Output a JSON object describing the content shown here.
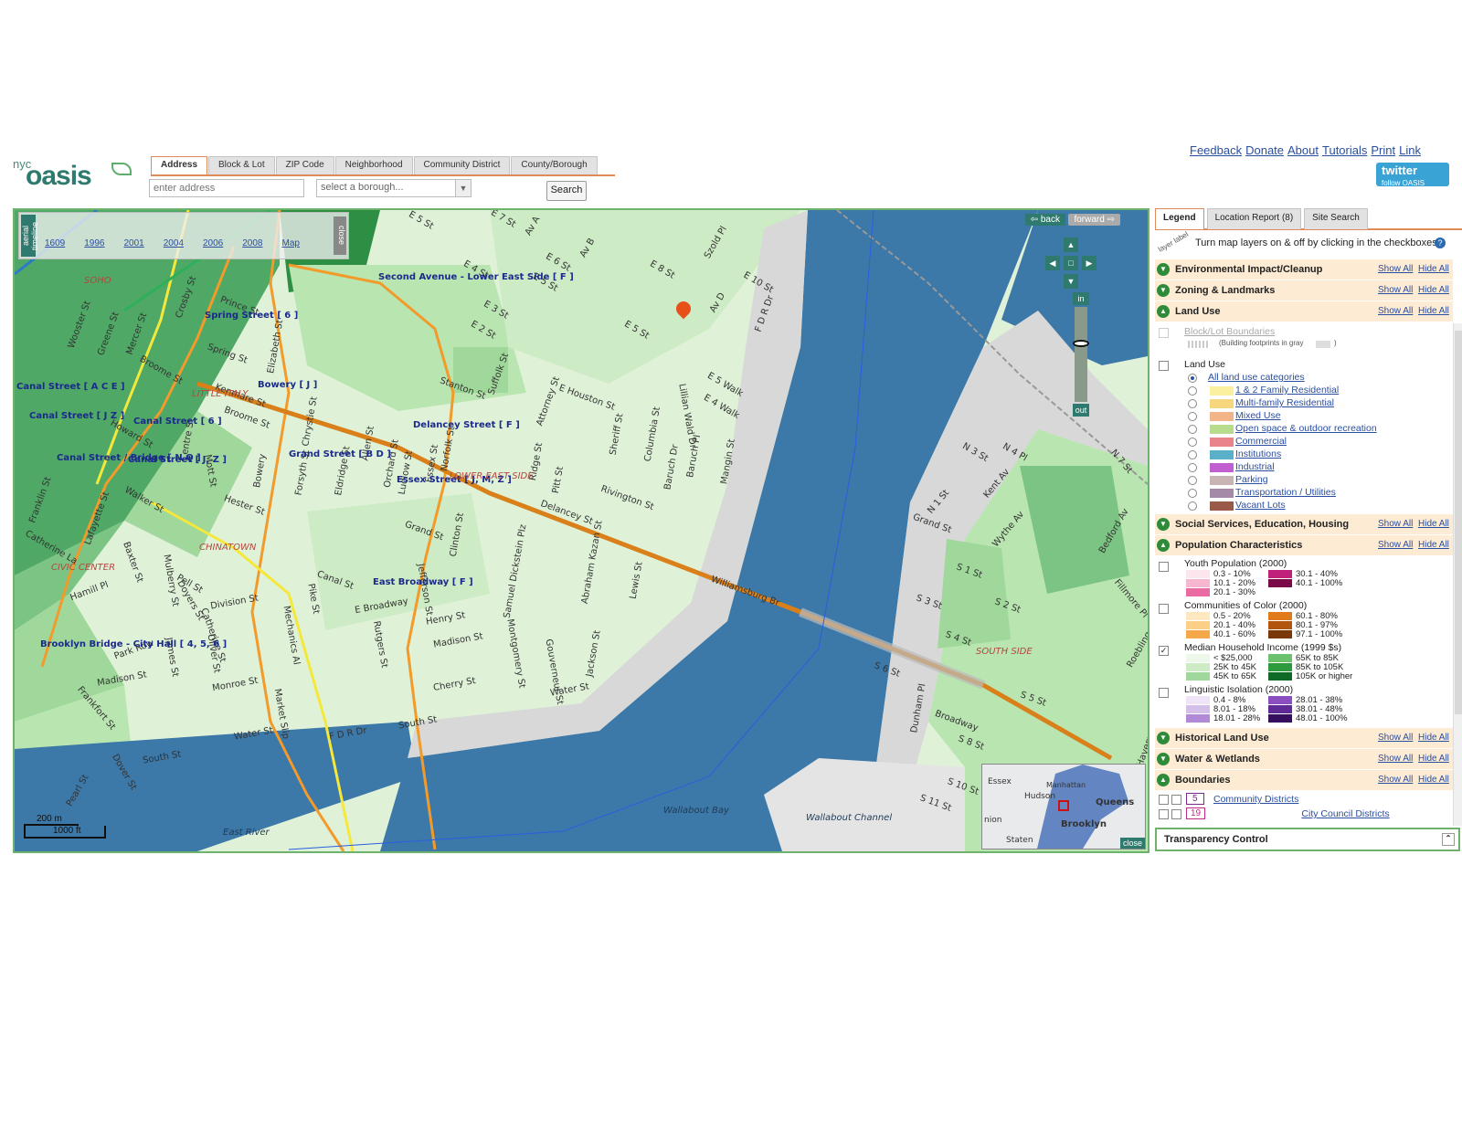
{
  "header": {
    "logo_small": "nyc",
    "logo_big": "oasis",
    "search_tabs": [
      "Address",
      "Block & Lot",
      "ZIP Code",
      "Neighborhood",
      "Community District",
      "County/Borough"
    ],
    "address_placeholder": "enter address",
    "borough_placeholder": "select a borough...",
    "search_label": "Search",
    "links": [
      "Feedback",
      "Donate",
      "About",
      "Tutorials",
      "Print",
      "Link"
    ],
    "twitter": "twitter",
    "twitter_sub": "follow OASIS"
  },
  "map": {
    "timeline_label": "aerial timeline",
    "timeline_years": [
      "1609",
      "1996",
      "2001",
      "2004",
      "2006",
      "2008",
      "Map"
    ],
    "timeline_close": "close",
    "back": "back",
    "forward": "forward",
    "zoom_in": "in",
    "zoom_out": "out",
    "overview_close": "close",
    "overview_labels": [
      "Essex",
      "Hudson",
      "Manhattan",
      "Queens",
      "Brooklyn",
      "Staten",
      "nion"
    ],
    "scale_m": "200 m",
    "scale_ft": "1000 ft",
    "streets": [
      "E 5 St",
      "E 7 St",
      "Av A",
      "E 4 St",
      "E 6 St",
      "Av B",
      "E 8 St",
      "Szold Pl",
      "E 3 St",
      "E 5 St",
      "E 2 St",
      "E 5 St",
      "Av D",
      "E 10 St",
      "F D R Dr",
      "E 5 Walk",
      "E 4 Walk",
      "E Houston St",
      "Stanton St",
      "Suffolk St",
      "Attorney St",
      "Rivington St",
      "Delancey St",
      "Grand St",
      "Broome St",
      "Hester St",
      "Canal St",
      "E Broadway",
      "Henry St",
      "Madison St",
      "Cherry St",
      "Water St",
      "South St",
      "Pike St",
      "Rutgers St",
      "Jefferson St",
      "Division St",
      "Catherine St",
      "Monroe St",
      "Market Slip",
      "Madison St",
      "Walker St",
      "Baxter St",
      "Mulberry St",
      "Mott St",
      "Bowery",
      "Elizabeth St",
      "Chrystie St",
      "Forsyth St",
      "Eldridge St",
      "Allen St",
      "Orchard St",
      "Ludlow St",
      "Essex St",
      "Norfolk St",
      "Clinton St",
      "Ridge St",
      "Pitt St",
      "Sheriff St",
      "Columbia St",
      "Lewis St",
      "Mangin St",
      "Baruch Dr",
      "Baruch Pl",
      "Lillian Wald Dr",
      "Jackson St",
      "Montgomery St",
      "Gouverneur St",
      "Samuel Dickstein Plz",
      "Abraham Kazan St",
      "Williamsburg Br",
      "Kenmare St",
      "Spring St",
      "Prince St",
      "Crosby St",
      "Mercer St",
      "Greene St",
      "Wooster St",
      "Broome St",
      "Howard St",
      "Lafayette St",
      "Centre St",
      "Franklin St",
      "Catherine La",
      "Park Row",
      "Hamill Pl",
      "Pearl St",
      "Dover St",
      "Frankfort St",
      "Water St",
      "South St",
      "Pell St",
      "Doyers St",
      "Oliver St",
      "James St",
      "Mechanics Al",
      "F D R Dr",
      "Grand St",
      "Broadway",
      "S 1 St",
      "S 2 St",
      "S 3 St",
      "S 4 St",
      "S 5 St",
      "S 6 St",
      "S 8 St",
      "S 10 St",
      "S 11 St",
      "N 1 St",
      "N 3 St",
      "N 4 Pl",
      "N 7 St",
      "Kent Av",
      "Wythe Av",
      "Bedford Av",
      "Dunham Pl",
      "Roebling St",
      "Havemeyer St",
      "Fillmore Pl"
    ],
    "subway": [
      "Second Avenue - Lower East Side [ F ]",
      "Bowery [ J ]",
      "Grand Street [ B D ]",
      "Spring Street [ 6 ]",
      "Canal Street [ A C E ]",
      "Canal Street [ 6 ]",
      "Canal Street / Bridge [ N Q ]",
      "Canal Street [ J Z ]",
      "Canal Street [ J, Z ]",
      "East Broadway [ F ]",
      "Brooklyn Bridge - City Hall [ 4, 5, 6 ]",
      "Essex Street [ J, M, Z ]",
      "Delancey Street [ F ]"
    ],
    "areas": [
      "SOHO",
      "LITTLE ITALY",
      "CHINATOWN",
      "LOWER EAST SIDE",
      "CIVIC CENTER",
      "SOUTH SIDE"
    ],
    "water": [
      "East River",
      "Wallabout Bay",
      "Wallabout Channel"
    ],
    "markers": [
      "N",
      "Q",
      "D",
      "M",
      "L"
    ]
  },
  "panel": {
    "tabs": [
      "Legend",
      "Location Report (8)",
      "Site Search"
    ],
    "layer_label": "layer label",
    "hint": "Turn map layers on & off by clicking in the checkboxes",
    "show_all": "Show All",
    "hide_all": "Hide All",
    "sections": [
      "Environmental Impact/Cleanup",
      "Zoning & Landmarks",
      "Land Use",
      "Social Services, Education, Housing",
      "Population Characteristics",
      "Historical Land Use",
      "Water & Wetlands",
      "Boundaries"
    ],
    "block_lot": "Block/Lot Boundaries",
    "block_lot_note": "(Building footprints in gray",
    "block_lot_close": ")",
    "land_use_title": "Land Use",
    "land_use_items": [
      {
        "label": "All land use categories",
        "color": ""
      },
      {
        "label": "1 & 2 Family Residential",
        "color": "#fbf0a0"
      },
      {
        "label": "Multi-family Residential",
        "color": "#f7d77e"
      },
      {
        "label": "Mixed Use",
        "color": "#f2b58a"
      },
      {
        "label": "Open space & outdoor recreation",
        "color": "#b8dc8e"
      },
      {
        "label": "Commercial",
        "color": "#e9848a"
      },
      {
        "label": "Institutions",
        "color": "#5ab0c8"
      },
      {
        "label": "Industrial",
        "color": "#c25fd0"
      },
      {
        "label": "Parking",
        "color": "#c9b4b4"
      },
      {
        "label": "Transportation / Utilities",
        "color": "#a58aa8"
      },
      {
        "label": "Vacant Lots",
        "color": "#9a5a4a"
      }
    ],
    "youth": {
      "title": "Youth Population (2000)",
      "items": [
        {
          "label": "0.3 - 10%",
          "color": "#fbe6ee"
        },
        {
          "label": "30.1 - 40%",
          "color": "#c0207a"
        },
        {
          "label": "10.1 - 20%",
          "color": "#f6b6cf"
        },
        {
          "label": "40.1 - 100%",
          "color": "#7a0a48"
        },
        {
          "label": "20.1 - 30%",
          "color": "#ea6aa2"
        }
      ]
    },
    "color": {
      "title": "Communities of Color (2000)",
      "items": [
        {
          "label": "0.5 - 20%",
          "color": "#fde8c0"
        },
        {
          "label": "60.1 - 80%",
          "color": "#e07a1a"
        },
        {
          "label": "20.1 - 40%",
          "color": "#fbcf85"
        },
        {
          "label": "80.1 - 97%",
          "color": "#b2560f"
        },
        {
          "label": "40.1 - 60%",
          "color": "#f5a84a"
        },
        {
          "label": "97.1 - 100%",
          "color": "#7a3808"
        }
      ]
    },
    "income": {
      "title": "Median Household Income (1999 $s)",
      "items": [
        {
          "label": "< $25,000",
          "color": "#eef8ea"
        },
        {
          "label": "65K to 85K",
          "color": "#6cc26c"
        },
        {
          "label": "25K to 45K",
          "color": "#cdebc4"
        },
        {
          "label": "85K to 105K",
          "color": "#2e9a3e"
        },
        {
          "label": "45K to 65K",
          "color": "#9fd89a"
        },
        {
          "label": "105K or higher",
          "color": "#0e6a26"
        }
      ]
    },
    "linguistic": {
      "title": "Linguistic Isolation (2000)",
      "items": [
        {
          "label": "0.4 - 8%",
          "color": "#efe4f5"
        },
        {
          "label": "28.01 - 38%",
          "color": "#8a4ec0"
        },
        {
          "label": "8.01 - 18%",
          "color": "#d4bfe8"
        },
        {
          "label": "38.01 - 48%",
          "color": "#5e2a96"
        },
        {
          "label": "18.01 - 28%",
          "color": "#b08ad6"
        },
        {
          "label": "48.01 - 100%",
          "color": "#36105e"
        }
      ]
    },
    "boundaries": [
      {
        "num": "5",
        "label": "Community Districts"
      },
      {
        "num": "19",
        "label": "City Council Districts"
      }
    ],
    "transparency": "Transparency Control"
  }
}
